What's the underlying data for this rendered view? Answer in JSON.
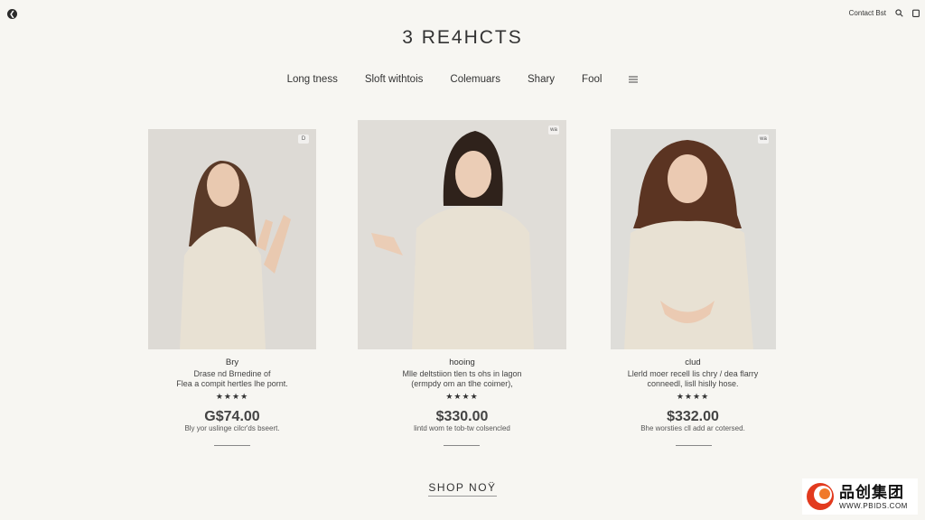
{
  "header": {
    "contact_label": "Contact Bst",
    "title": "3 RE4HCTS"
  },
  "nav": {
    "items": [
      "Long tness",
      "Sloft withtois",
      "Colemuars",
      "Shary",
      "Fool"
    ]
  },
  "products": [
    {
      "badge": "D",
      "name": "Bry",
      "desc_line1": "Drase nd Brnedine of",
      "desc_line2": "Flea a compit hertles lhe pornt.",
      "stars": "★★★★",
      "price": "G$74.00",
      "subtext": "Bly yor uslinge cilcr'ds bseert."
    },
    {
      "badge": "wa",
      "name": "hooing",
      "desc_line1": "Mlle deltstiion tlen ts ohs in lagon",
      "desc_line2": "(ermpdy om an tlhe coimer),",
      "stars": "★★★★",
      "price": "$330.00",
      "subtext": "lintd wom te tob-tw colsencled"
    },
    {
      "badge": "wa",
      "name": "clud",
      "desc_line1": "Llerld moer recell lis chry / dea flarry",
      "desc_line2": "conneedl, lisll hislly hose.",
      "stars": "★★★★",
      "price": "$332.00",
      "subtext": "Bhe worsties cll add ar cotersed."
    }
  ],
  "cta": {
    "label": "SHOP NOŸ"
  },
  "watermark": {
    "brand": "品创集团",
    "url": "WWW.PBIDS.COM"
  },
  "colors": {
    "background": "#f7f6f2",
    "dress": "#e8e1d3",
    "photo_bg": "#dddad5",
    "watermark_red": "#e23a1e"
  }
}
